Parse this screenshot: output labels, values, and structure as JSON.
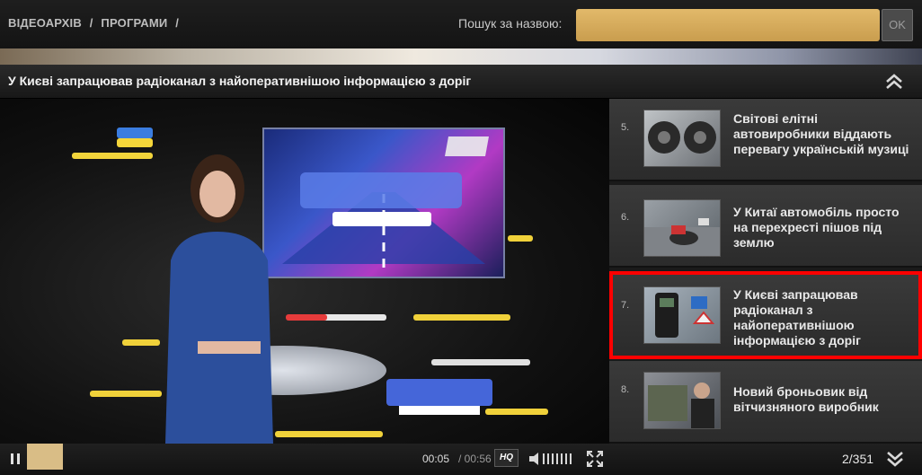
{
  "breadcrumb": {
    "items": [
      "ВІДЕОАРХІВ",
      "ПРОГРАМИ"
    ],
    "separator": "/"
  },
  "search": {
    "label": "Пошук за назвою:",
    "value": "",
    "button_label": "OK"
  },
  "video": {
    "title": "У Києві запрацював радіоканал з найоперативнішою інформацією з доріг"
  },
  "playlist": {
    "items": [
      {
        "number": "5.",
        "title": "Світові елітні автовиробники віддають перевагу українській музиці",
        "thumb": "speakers-thumbnail"
      },
      {
        "number": "6.",
        "title": "У Китаї автомобіль просто на перехресті пішов під землю",
        "thumb": "road-sinkhole-thumbnail"
      },
      {
        "number": "7.",
        "title": "У Києві запрацював радіоканал з найоперативнішою інформацією з доріг",
        "thumb": "radio-device-thumbnail",
        "selected": true
      },
      {
        "number": "8.",
        "title": "Новий броньовик від вітчизняного виробник",
        "thumb": "armored-vehicle-thumbnail"
      }
    ]
  },
  "controls": {
    "time_current": "00:05",
    "time_total": "/ 00:56",
    "quality_label": "HQ",
    "page_counter": "2/351",
    "progress_fraction": 0.09
  },
  "colors": {
    "search_field": "#d6ad5e",
    "progress": "#d9bd86",
    "selection_border": "#ff0000"
  }
}
